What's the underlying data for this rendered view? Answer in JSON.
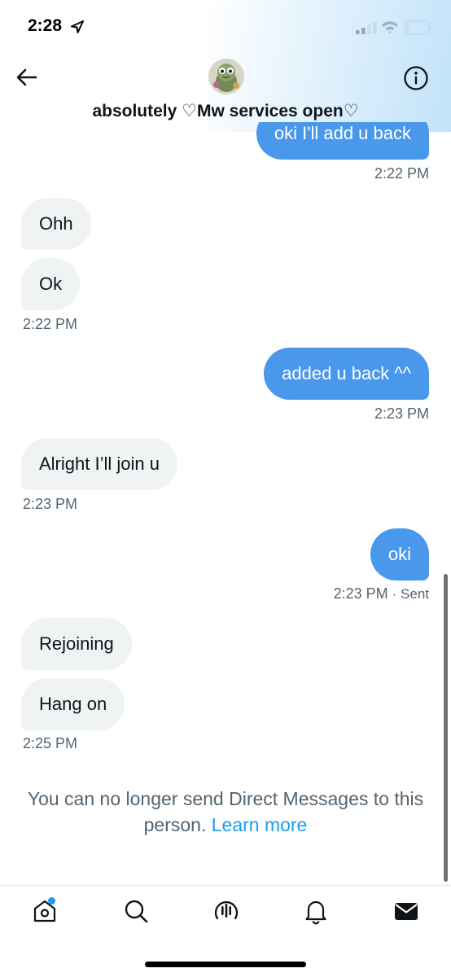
{
  "status_bar": {
    "time": "2:28"
  },
  "header": {
    "title": "absolutely ♡Mw services open♡"
  },
  "messages": [
    {
      "direction": "out",
      "text": "oki I'll add u back",
      "partial": true
    },
    {
      "direction": "out_ts",
      "timestamp": "2:22 PM"
    },
    {
      "direction": "in",
      "text": "Ohh"
    },
    {
      "direction": "in",
      "text": "Ok"
    },
    {
      "direction": "in_ts",
      "timestamp": "2:22 PM"
    },
    {
      "direction": "out",
      "text": "added u back ^^"
    },
    {
      "direction": "out_ts",
      "timestamp": "2:23 PM"
    },
    {
      "direction": "in",
      "text": "Alright I’ll join u"
    },
    {
      "direction": "in_ts",
      "timestamp": "2:23 PM"
    },
    {
      "direction": "out",
      "text": "oki"
    },
    {
      "direction": "out_ts",
      "timestamp": "2:23 PM",
      "status": "· Sent"
    },
    {
      "direction": "in",
      "text": "Rejoining"
    },
    {
      "direction": "in",
      "text": "Hang on"
    },
    {
      "direction": "in_ts",
      "timestamp": "2:25 PM"
    }
  ],
  "notice": {
    "text": "You can no longer send Direct Messages to this person.",
    "link": "Learn more"
  },
  "tabs": [
    {
      "icon": "home-icon",
      "has_badge": true
    },
    {
      "icon": "search-icon"
    },
    {
      "icon": "spaces-icon"
    },
    {
      "icon": "bell-icon"
    },
    {
      "icon": "mail-icon",
      "active": true
    }
  ],
  "colors": {
    "accent": "#1d9bf0",
    "outgoing_bubble": "#4a98ec",
    "incoming_bubble": "#eff3f4",
    "secondary_text": "#536471"
  }
}
